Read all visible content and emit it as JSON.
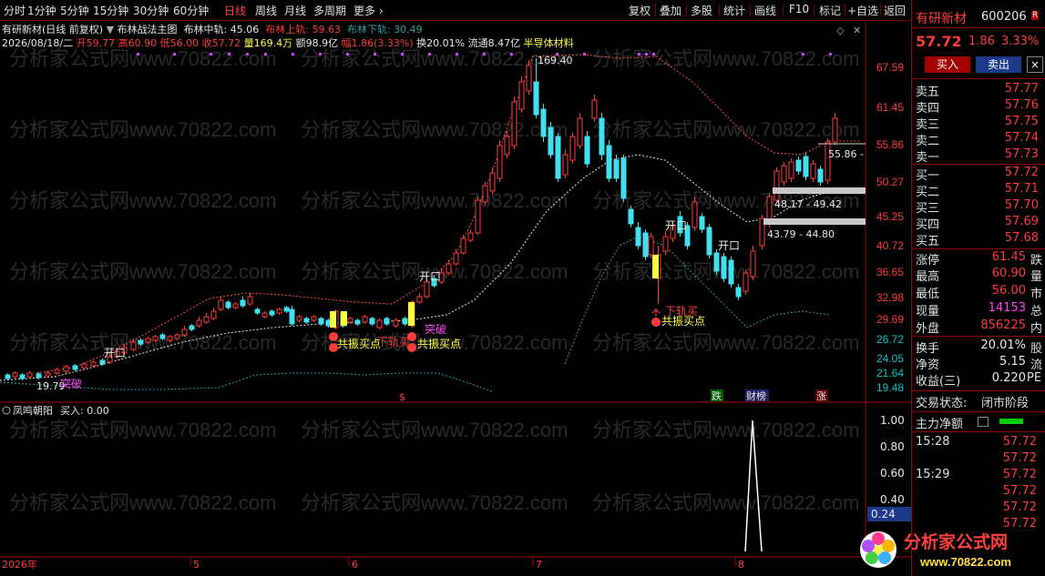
{
  "toolbar": {
    "tabs": [
      "分时",
      "1分钟",
      "5分钟",
      "15分钟",
      "30分钟",
      "60分钟",
      "日线",
      "周线",
      "月线",
      "多周期",
      "更多 ›"
    ],
    "active_tab": 6,
    "right_buttons": [
      "复权",
      "叠加",
      "多股",
      "统计",
      "画线",
      "F10",
      "标记",
      "+自选",
      "返回"
    ]
  },
  "header": {
    "title": "有研新材(日线 前复权)",
    "indicator_name": "布林战法主图",
    "mid_label": "布林中轨: 45.06",
    "up_label": "布林上轨: 59.63",
    "low_label": "布林下轨: 30.49",
    "date": "2026/08/18/二",
    "open": "开59.77",
    "high": "高60.90",
    "low": "低56.00",
    "close": "收57.72",
    "volume": "量169.4万",
    "amount": "额98.9亿",
    "amplitude": "幅1.86(3.33%)",
    "turnover": "换20.01%",
    "float": "流通8.47亿",
    "sector": "半导体材料"
  },
  "price_axis": [
    "67.59",
    "61.45",
    "55.86",
    "50.27",
    "45.25",
    "40.72",
    "36.65",
    "32.98",
    "29.69",
    "26.72",
    "24.05",
    "21.64",
    "19.48"
  ],
  "annotations": {
    "high_mark": "169.40",
    "low_mark": "19.79",
    "zones": [
      "55.86 -",
      "48.17 - 49.42",
      "43.79 - 44.80"
    ],
    "signals": [
      "开口",
      "开口",
      "开口",
      "突破",
      "突破",
      "下轨买",
      "下轨买",
      "共振买点",
      "共振买点",
      "共振买点"
    ],
    "bottom_tags": [
      "跌",
      "财榜",
      "涨",
      "$"
    ]
  },
  "sub_chart": {
    "title": "凤鸣朝阳",
    "value_label": "买入: 0.00",
    "axis": [
      "1.00",
      "0.80",
      "0.60",
      "0.40",
      "0.24"
    ]
  },
  "time_axis": [
    "2026年",
    "5",
    "6",
    "7",
    "8"
  ],
  "watermark": "分析家公式网www.70822.com",
  "right_panel": {
    "name": "有研新材",
    "code": "600206",
    "price": "57.72",
    "change": "1.86",
    "pct": "3.33%",
    "buy_btn": "买入",
    "sell_btn": "卖出",
    "asks": [
      {
        "label": "卖五",
        "price": "57.77"
      },
      {
        "label": "卖四",
        "price": "57.76"
      },
      {
        "label": "卖三",
        "price": "57.75"
      },
      {
        "label": "卖二",
        "price": "57.74"
      },
      {
        "label": "卖一",
        "price": "57.73"
      }
    ],
    "bids": [
      {
        "label": "买一",
        "price": "57.72"
      },
      {
        "label": "买二",
        "price": "57.71"
      },
      {
        "label": "买三",
        "price": "57.70"
      },
      {
        "label": "买四",
        "price": "57.69"
      },
      {
        "label": "买五",
        "price": "57.68"
      }
    ],
    "stats": [
      {
        "label": "涨停",
        "value": "61.45",
        "extra": "跌"
      },
      {
        "label": "最高",
        "value": "60.90",
        "extra": "量"
      },
      {
        "label": "最低",
        "value": "56.00",
        "extra": "市"
      },
      {
        "label": "现量",
        "value": "14153",
        "extra": "总"
      },
      {
        "label": "外盘",
        "value": "856225",
        "extra": "内"
      }
    ],
    "stats2": [
      {
        "label": "换手",
        "value": "20.01%",
        "extra": "股"
      },
      {
        "label": "净资",
        "value": "5.15",
        "extra": "流"
      },
      {
        "label": "收益(三)",
        "value": "0.220",
        "extra": "PE"
      }
    ],
    "trade_status_label": "交易状态:",
    "trade_status": "闭市阶段",
    "net_flow_label": "主力净额",
    "ticks": [
      {
        "time": "15:28",
        "price": "57.72"
      },
      {
        "time": "",
        "price": "57.72"
      },
      {
        "time": "15:29",
        "price": "57.72"
      },
      {
        "time": "",
        "price": "57.72"
      },
      {
        "time": "",
        "price": "57.72"
      },
      {
        "time": "",
        "price": "57.72"
      }
    ]
  },
  "logo": {
    "main": "分析家公式网",
    "url": "www.70822.com"
  }
}
